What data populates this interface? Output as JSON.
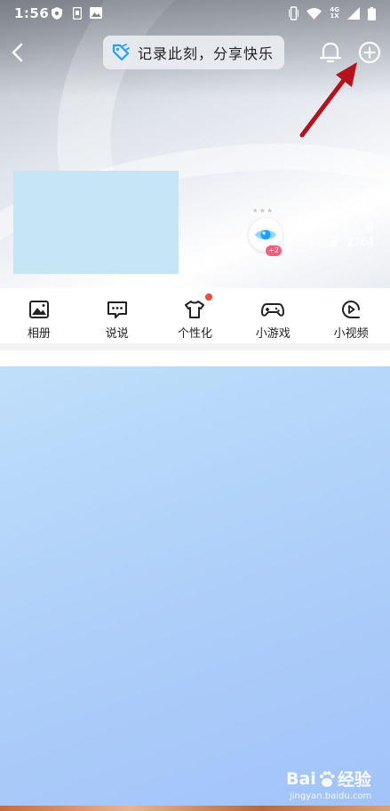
{
  "status_bar": {
    "time": "1:56",
    "network": "4G",
    "network_sub": "1X"
  },
  "nav": {
    "share_text": "记录此刻，分享快乐"
  },
  "visitors": {
    "stars": "★★★",
    "badge": "+2",
    "today_label": "今日访客",
    "today_value": "0",
    "total_label": "访客总量",
    "total_value": "2764"
  },
  "tools": [
    {
      "label": "相册",
      "icon": "album-icon"
    },
    {
      "label": "说说",
      "icon": "chat-icon"
    },
    {
      "label": "个性化",
      "icon": "tshirt-icon"
    },
    {
      "label": "小游戏",
      "icon": "gamepad-icon"
    },
    {
      "label": "小视频",
      "icon": "video-icon"
    }
  ],
  "watermark": {
    "brand": "Bai",
    "brand_cn": "经验",
    "url": "jingyan.baidu.com"
  },
  "colors": {
    "accent": "#1aa3ff",
    "annotation_arrow": "#b5121b",
    "notice_dot": "#f04a3c"
  }
}
